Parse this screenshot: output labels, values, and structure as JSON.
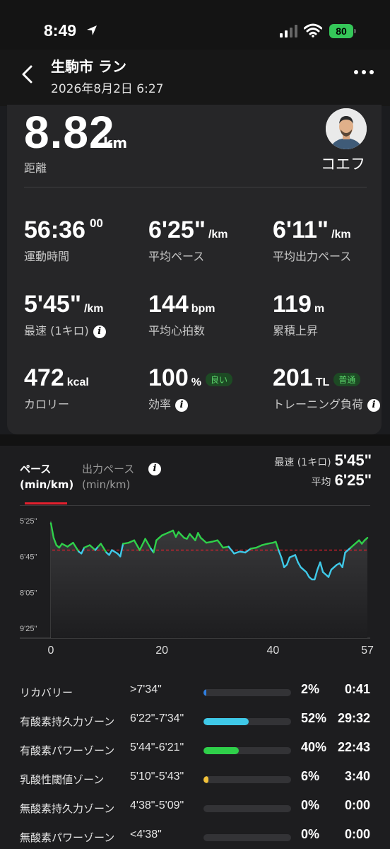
{
  "status_bar": {
    "time": "8:49",
    "battery": "80"
  },
  "header": {
    "title": "生駒市 ラン",
    "date": "2026年8月2日 6:27"
  },
  "summary": {
    "distance_value": "8.82",
    "distance_unit": "km",
    "distance_label": "距離",
    "user_name": "コエフ"
  },
  "metrics": [
    {
      "value": "56:36",
      "sup": "00",
      "unit": "",
      "label": "運動時間"
    },
    {
      "value": "6'25\"",
      "unit": "/km",
      "label": "平均ペース"
    },
    {
      "value": "6'11\"",
      "unit": "/km",
      "label": "平均出力ペース"
    },
    {
      "value": "5'45\"",
      "unit": "/km",
      "label": "最速 (1キロ)"
    },
    {
      "value": "144",
      "unit": "bpm",
      "label": "平均心拍数"
    },
    {
      "value": "119",
      "unit": "m",
      "label": "累積上昇"
    },
    {
      "value": "472",
      "unit": "kcal",
      "label": "カロリー"
    },
    {
      "value": "100",
      "unit": "%",
      "badge": "良い",
      "label": "効率"
    },
    {
      "value": "201",
      "unit": "TL",
      "badge": "普通",
      "label": "トレーニング負荷"
    }
  ],
  "chart_tabs": {
    "active_line1": "ペース",
    "active_line2": "(min/km)",
    "inactive_line1": "出力ペース",
    "inactive_line2": "(min/km)"
  },
  "chart_stats": {
    "fastest_label": "最速 (1キロ)",
    "fastest_value": "5'45\"",
    "avg_label": "平均",
    "avg_value": "6'25\""
  },
  "chart_data": {
    "type": "line",
    "y_ticks": [
      "5'25\"",
      "6'45\"",
      "8'05\"",
      "9'25\""
    ],
    "x_ticks": [
      "0",
      "20",
      "40",
      "57"
    ],
    "xlim": [
      0,
      57
    ],
    "ylim_sec_per_km": [
      325,
      565
    ],
    "average_line_sec_per_km": 385,
    "x": [
      0,
      0.5,
      1,
      1.5,
      2,
      3,
      4,
      5,
      5.5,
      6,
      7,
      8,
      8.5,
      9,
      10,
      10.5,
      11,
      12,
      12.5,
      13,
      14,
      15,
      16,
      17,
      18,
      18.5,
      19,
      19.5,
      20,
      21,
      22,
      22.5,
      23,
      24,
      24.5,
      25,
      26,
      26.5,
      27,
      28,
      29,
      30,
      30.5,
      31,
      32,
      33,
      34,
      35,
      36,
      37,
      38,
      39,
      40,
      40.5,
      41,
      41.5,
      42,
      42.5,
      43,
      44,
      44.5,
      45,
      45.5,
      46,
      46.5,
      47,
      47.5,
      48,
      48.5,
      49,
      50,
      50.5,
      51,
      51.5,
      52,
      52.5,
      53,
      54,
      54.5,
      55,
      55.5,
      56,
      56.5,
      57
    ],
    "y": [
      330,
      360,
      375,
      380,
      372,
      378,
      370,
      388,
      392,
      380,
      375,
      385,
      378,
      372,
      390,
      395,
      385,
      392,
      398,
      372,
      370,
      365,
      385,
      362,
      382,
      390,
      365,
      360,
      355,
      350,
      345,
      358,
      348,
      360,
      362,
      352,
      365,
      350,
      360,
      370,
      368,
      365,
      372,
      380,
      378,
      392,
      388,
      390,
      382,
      380,
      375,
      372,
      370,
      368,
      385,
      400,
      420,
      415,
      400,
      395,
      410,
      420,
      425,
      430,
      440,
      445,
      445,
      425,
      410,
      430,
      440,
      425,
      420,
      415,
      412,
      420,
      390,
      380,
      375,
      370,
      365,
      372,
      365,
      360,
      370
    ],
    "zones": [
      {
        "name": "リカバリー",
        "range": ">7'34\"",
        "percent": "2%",
        "time": "0:41",
        "fraction": 0.02,
        "color": "#2f7fe0"
      },
      {
        "name": "有酸素持久力ゾーン",
        "range": "6'22\"-7'34\"",
        "percent": "52%",
        "time": "29:32",
        "fraction": 0.52,
        "color": "#3fc9e8"
      },
      {
        "name": "有酸素パワーゾーン",
        "range": "5'44\"-6'21\"",
        "percent": "40%",
        "time": "22:43",
        "fraction": 0.4,
        "color": "#2fd04a"
      },
      {
        "name": "乳酸性閾値ゾーン",
        "range": "5'10\"-5'43\"",
        "percent": "6%",
        "time": "3:40",
        "fraction": 0.06,
        "color": "#f2c23a"
      },
      {
        "name": "無酸素持久力ゾーン",
        "range": "4'38\"-5'09\"",
        "percent": "0%",
        "time": "0:00",
        "fraction": 0.0,
        "color": "#f07a2a"
      },
      {
        "name": "無酸素パワーゾーン",
        "range": "<4'38\"",
        "percent": "0%",
        "time": "0:00",
        "fraction": 0.0,
        "color": "#e53030"
      }
    ]
  }
}
